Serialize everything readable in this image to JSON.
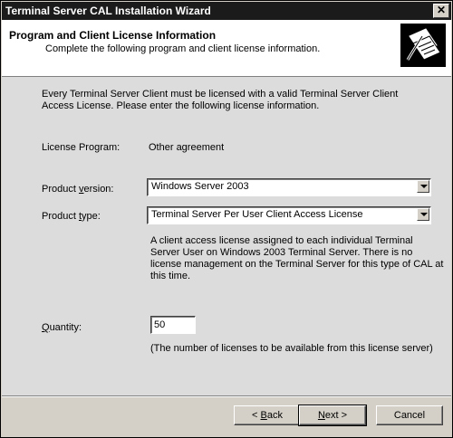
{
  "window": {
    "title": "Terminal Server CAL Installation Wizard",
    "close_glyph": "✕"
  },
  "header": {
    "title": "Program and Client License Information",
    "subtitle": "Complete the following program and client license information."
  },
  "intro": {
    "line1": "Every Terminal Server Client must be licensed with a valid Terminal Server Client",
    "line2": "Access License. Please enter the following license information."
  },
  "license_program": {
    "label": "License Program:",
    "value": "Other agreement"
  },
  "product_version": {
    "label_pre": "Product ",
    "label_key": "v",
    "label_post": "ersion:",
    "value": "Windows Server 2003"
  },
  "product_type": {
    "label_pre": "Product ",
    "label_key": "t",
    "label_post": "ype:",
    "value": "Terminal Server Per User Client Access License"
  },
  "description": {
    "line1": "A client access license assigned to each individual Terminal",
    "line2": "Server User on Windows 2003 Terminal Server. There is no",
    "line3": "license management on the Terminal Server for this type of CAL at",
    "line4": "this time."
  },
  "quantity": {
    "label_key": "Q",
    "label_post": "uantity:",
    "value": "50",
    "hint": "(The number of licenses to be available from this license server)"
  },
  "buttons": {
    "back_prefix": "< ",
    "back_key": "B",
    "back_post": "ack",
    "next_key": "N",
    "next_post": "ext >",
    "cancel": "Cancel"
  },
  "icons": {
    "header": "license-document-pen-icon",
    "arrow": "chevron-down-icon"
  }
}
